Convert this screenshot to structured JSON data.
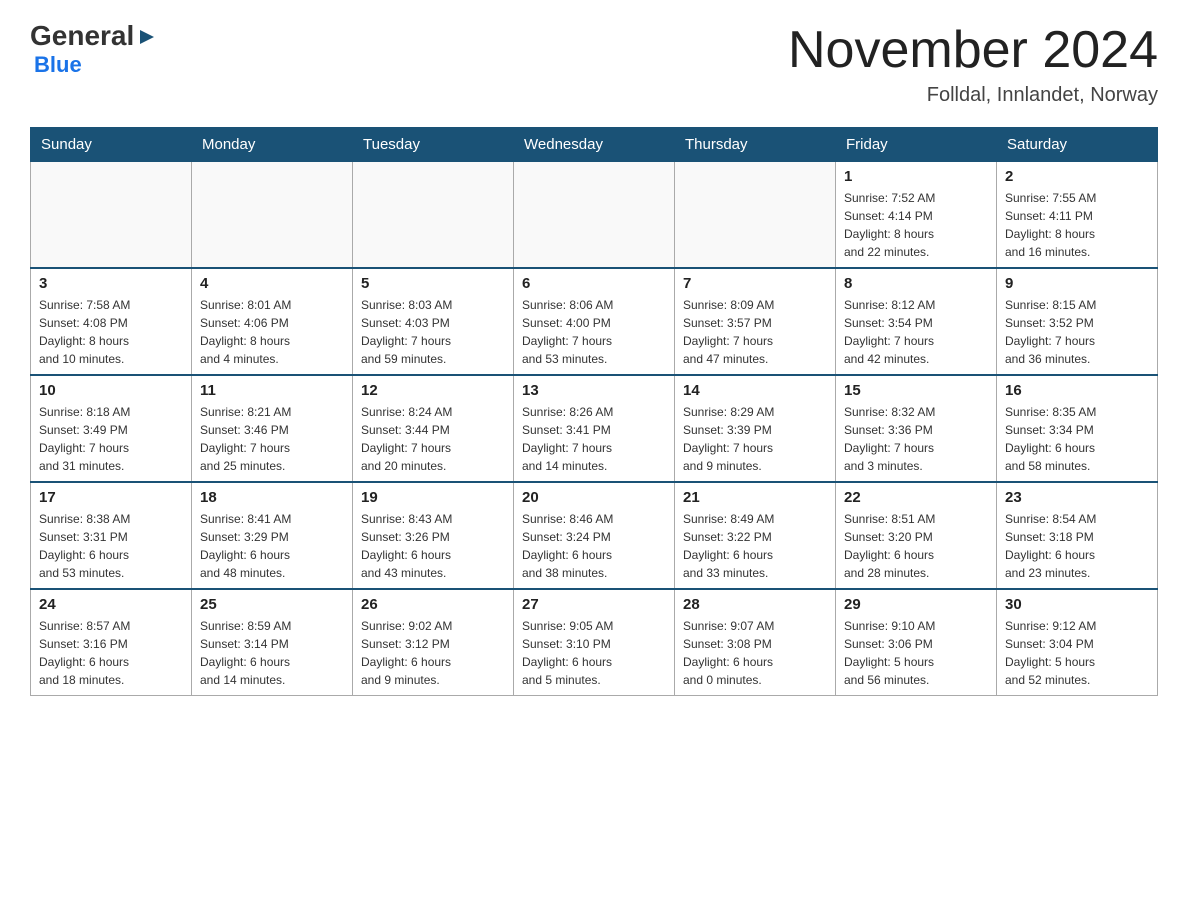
{
  "logo": {
    "general": "General",
    "blue": "Blue"
  },
  "title": "November 2024",
  "location": "Folldal, Innlandet, Norway",
  "days_of_week": [
    "Sunday",
    "Monday",
    "Tuesday",
    "Wednesday",
    "Thursday",
    "Friday",
    "Saturday"
  ],
  "weeks": [
    [
      {
        "day": "",
        "info": ""
      },
      {
        "day": "",
        "info": ""
      },
      {
        "day": "",
        "info": ""
      },
      {
        "day": "",
        "info": ""
      },
      {
        "day": "",
        "info": ""
      },
      {
        "day": "1",
        "info": "Sunrise: 7:52 AM\nSunset: 4:14 PM\nDaylight: 8 hours\nand 22 minutes."
      },
      {
        "day": "2",
        "info": "Sunrise: 7:55 AM\nSunset: 4:11 PM\nDaylight: 8 hours\nand 16 minutes."
      }
    ],
    [
      {
        "day": "3",
        "info": "Sunrise: 7:58 AM\nSunset: 4:08 PM\nDaylight: 8 hours\nand 10 minutes."
      },
      {
        "day": "4",
        "info": "Sunrise: 8:01 AM\nSunset: 4:06 PM\nDaylight: 8 hours\nand 4 minutes."
      },
      {
        "day": "5",
        "info": "Sunrise: 8:03 AM\nSunset: 4:03 PM\nDaylight: 7 hours\nand 59 minutes."
      },
      {
        "day": "6",
        "info": "Sunrise: 8:06 AM\nSunset: 4:00 PM\nDaylight: 7 hours\nand 53 minutes."
      },
      {
        "day": "7",
        "info": "Sunrise: 8:09 AM\nSunset: 3:57 PM\nDaylight: 7 hours\nand 47 minutes."
      },
      {
        "day": "8",
        "info": "Sunrise: 8:12 AM\nSunset: 3:54 PM\nDaylight: 7 hours\nand 42 minutes."
      },
      {
        "day": "9",
        "info": "Sunrise: 8:15 AM\nSunset: 3:52 PM\nDaylight: 7 hours\nand 36 minutes."
      }
    ],
    [
      {
        "day": "10",
        "info": "Sunrise: 8:18 AM\nSunset: 3:49 PM\nDaylight: 7 hours\nand 31 minutes."
      },
      {
        "day": "11",
        "info": "Sunrise: 8:21 AM\nSunset: 3:46 PM\nDaylight: 7 hours\nand 25 minutes."
      },
      {
        "day": "12",
        "info": "Sunrise: 8:24 AM\nSunset: 3:44 PM\nDaylight: 7 hours\nand 20 minutes."
      },
      {
        "day": "13",
        "info": "Sunrise: 8:26 AM\nSunset: 3:41 PM\nDaylight: 7 hours\nand 14 minutes."
      },
      {
        "day": "14",
        "info": "Sunrise: 8:29 AM\nSunset: 3:39 PM\nDaylight: 7 hours\nand 9 minutes."
      },
      {
        "day": "15",
        "info": "Sunrise: 8:32 AM\nSunset: 3:36 PM\nDaylight: 7 hours\nand 3 minutes."
      },
      {
        "day": "16",
        "info": "Sunrise: 8:35 AM\nSunset: 3:34 PM\nDaylight: 6 hours\nand 58 minutes."
      }
    ],
    [
      {
        "day": "17",
        "info": "Sunrise: 8:38 AM\nSunset: 3:31 PM\nDaylight: 6 hours\nand 53 minutes."
      },
      {
        "day": "18",
        "info": "Sunrise: 8:41 AM\nSunset: 3:29 PM\nDaylight: 6 hours\nand 48 minutes."
      },
      {
        "day": "19",
        "info": "Sunrise: 8:43 AM\nSunset: 3:26 PM\nDaylight: 6 hours\nand 43 minutes."
      },
      {
        "day": "20",
        "info": "Sunrise: 8:46 AM\nSunset: 3:24 PM\nDaylight: 6 hours\nand 38 minutes."
      },
      {
        "day": "21",
        "info": "Sunrise: 8:49 AM\nSunset: 3:22 PM\nDaylight: 6 hours\nand 33 minutes."
      },
      {
        "day": "22",
        "info": "Sunrise: 8:51 AM\nSunset: 3:20 PM\nDaylight: 6 hours\nand 28 minutes."
      },
      {
        "day": "23",
        "info": "Sunrise: 8:54 AM\nSunset: 3:18 PM\nDaylight: 6 hours\nand 23 minutes."
      }
    ],
    [
      {
        "day": "24",
        "info": "Sunrise: 8:57 AM\nSunset: 3:16 PM\nDaylight: 6 hours\nand 18 minutes."
      },
      {
        "day": "25",
        "info": "Sunrise: 8:59 AM\nSunset: 3:14 PM\nDaylight: 6 hours\nand 14 minutes."
      },
      {
        "day": "26",
        "info": "Sunrise: 9:02 AM\nSunset: 3:12 PM\nDaylight: 6 hours\nand 9 minutes."
      },
      {
        "day": "27",
        "info": "Sunrise: 9:05 AM\nSunset: 3:10 PM\nDaylight: 6 hours\nand 5 minutes."
      },
      {
        "day": "28",
        "info": "Sunrise: 9:07 AM\nSunset: 3:08 PM\nDaylight: 6 hours\nand 0 minutes."
      },
      {
        "day": "29",
        "info": "Sunrise: 9:10 AM\nSunset: 3:06 PM\nDaylight: 5 hours\nand 56 minutes."
      },
      {
        "day": "30",
        "info": "Sunrise: 9:12 AM\nSunset: 3:04 PM\nDaylight: 5 hours\nand 52 minutes."
      }
    ]
  ]
}
